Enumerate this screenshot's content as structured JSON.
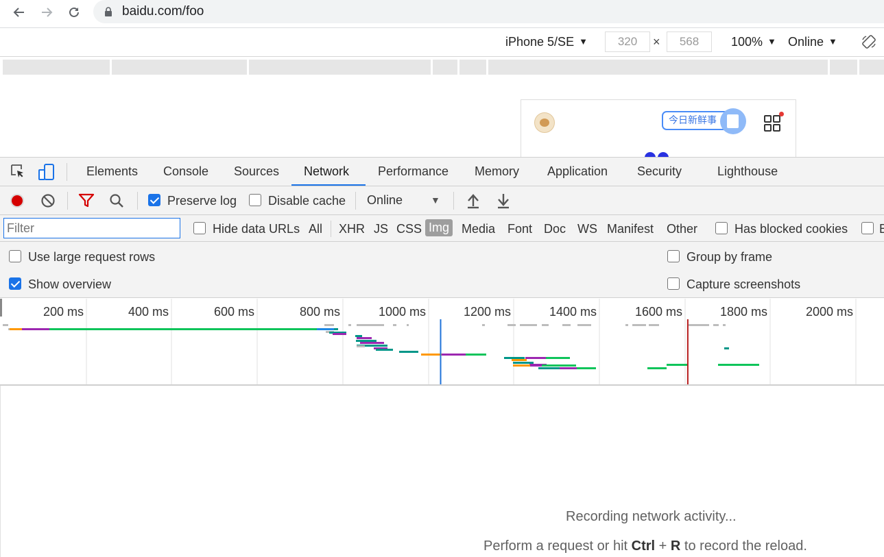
{
  "browser": {
    "url": "baidu.com/foo"
  },
  "device_toolbar": {
    "device": "iPhone 5/SE",
    "width": "320",
    "height": "568",
    "times": "×",
    "zoom": "100%",
    "network": "Online"
  },
  "page": {
    "news_label": "今日新鲜事"
  },
  "devtools": {
    "tabs": [
      "Elements",
      "Console",
      "Sources",
      "Network",
      "Performance",
      "Memory",
      "Application",
      "Security",
      "Lighthouse"
    ],
    "active_tab": "Network"
  },
  "network": {
    "preserve_log": {
      "label": "Preserve log",
      "checked": true
    },
    "disable_cache": {
      "label": "Disable cache",
      "checked": false
    },
    "throttling": "Online",
    "filter_placeholder": "Filter",
    "hide_data_urls": "Hide data URLs",
    "types": [
      "All",
      "XHR",
      "JS",
      "CSS",
      "Img",
      "Media",
      "Font",
      "Doc",
      "WS",
      "Manifest",
      "Other"
    ],
    "selected_type": "Img",
    "has_blocked_cookies": "Has blocked cookies",
    "blocked_requests_partial": "B",
    "use_large_rows": {
      "label": "Use large request rows",
      "checked": false
    },
    "show_overview": {
      "label": "Show overview",
      "checked": true
    },
    "group_by_frame": {
      "label": "Group by frame",
      "checked": false
    },
    "capture_screenshots": {
      "label": "Capture screenshots",
      "checked": false
    }
  },
  "overview": {
    "ticks": [
      "200 ms",
      "400 ms",
      "600 ms",
      "800 ms",
      "1000 ms",
      "1200 ms",
      "1400 ms",
      "1600 ms",
      "1800 ms",
      "2000 ms"
    ],
    "dom_content_loaded_ms": 1085,
    "load_ms": 1655,
    "colors": {
      "waiting": "#0fc45a",
      "content": "#9c27b0",
      "ssl": "#ff9800",
      "dns": "#009688",
      "stalled": "#bdbdbd",
      "queue": "#1e88e5",
      "dcl": "#1f72d9",
      "load": "#b71c1c"
    }
  },
  "empty_state": {
    "recording": "Recording network activity...",
    "hint_prefix": "Perform a request or hit ",
    "hint_key1": "Ctrl",
    "hint_plus": " + ",
    "hint_key2": "R",
    "hint_suffix": " to record the reload."
  }
}
